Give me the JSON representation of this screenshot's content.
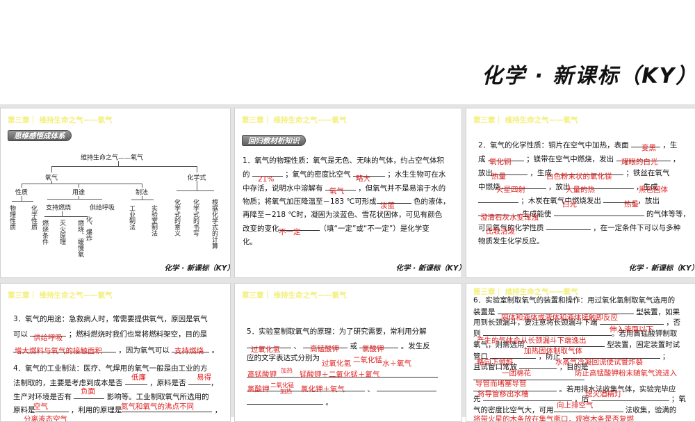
{
  "header": {
    "title": "化学 · 新课标（KY）"
  },
  "chapter": "第三章｜ 维持生命之气——氧气",
  "footer": "化学 · 新课标（KY）",
  "slide1": {
    "badge": "思维感悟成体系",
    "root": "维持生命之气——氧气",
    "oxygen": "氧气",
    "formula": "化学式",
    "property": "性质",
    "use": "用途",
    "method": "制法",
    "physical": "物理性质",
    "chemical": "化学性质",
    "support": "支持燃烧",
    "breath": "供给呼吸",
    "cond": "燃烧条件",
    "fire": "灭火原理",
    "slow1": "燃烧、缓慢氧",
    "slow2": "化、爆炸",
    "industry": "工业制法",
    "lab": "实验室制法",
    "meaning": "化学式的意义",
    "writing": "化学式的书写",
    "calc": "根据化学式的计算"
  },
  "slide2": {
    "badge": "回归教材析知识",
    "l1": "1．氧气的物理性质：氧气是无色、无味的气体，约占空气体积",
    "l2a": "的",
    "l2b": "；氧气的密度比空气",
    "l2c": "；水生生物可在水",
    "l3a": "中存活，说明水中溶解有",
    "l3b": "，但氧气并不是易溶于水的",
    "l4a": "物质；将氧气加压降温至－183 ℃可形成",
    "l4b": "色的液体，",
    "l5": "再降至－218 ℃时，凝固为淡蓝色、雪花状固体，可见有颜色",
    "l6a": "改变的变化",
    "l6b": "（填“一定”或“不一定”）是化学变",
    "l7": "化。",
    "answers": [
      "21%",
      "略大",
      "氧气",
      "淡蓝",
      "不一定"
    ]
  },
  "slide3": {
    "l1a": "2．氧气的化学性质：铜片在空气中加热，表面",
    "l1b": "，生",
    "l2a": "成",
    "l2b": "；镁带在空气中燃烧，发出",
    "l2c": "，",
    "l3a": "放出",
    "l3b": "，生成",
    "l3c": "；铁丝在氧气",
    "l4a": "中燃烧",
    "l4b": "，放出",
    "l4c": "，生成",
    "l5a": "；木炭在氧气中燃烧发出",
    "l5b": "，放出",
    "l6a": "生成能使",
    "l6b": "的气体等等，",
    "l7a": "可见氧气的化学性质",
    "l7b": "，在一定条件下可以与多种",
    "l8": "物质发生化学反应。",
    "answers": [
      "变黑",
      "氧化铜",
      "耀眼的白光",
      "热量",
      "白色粉末状的氧化镁",
      "火星四射",
      "大量的热",
      "黑色固体",
      "白光",
      "热量",
      "澄清石灰水变浑浊",
      "比较活泼"
    ]
  },
  "slide4": {
    "l1": "3．氧气的用途：急救病人时，常需要提供氧气，原因是氧气",
    "l2a": "可以",
    "l2b": "；燃料燃烧时我们也常将燃料架空，目的是",
    "l3a": "，因为氧气可以",
    "l3b": "。",
    "l4": "4．氧气的工业制法：医疗、气焊用的氧气一般是由工业的方",
    "l5a": "法制取的，主要是考虑到成本是否",
    "l5b": "，原料是否",
    "l5c": "，",
    "l6a": "生产对环境是否有",
    "l6b": "影响等。工业制取氧气所选用的",
    "l7a": "原料是",
    "l7b": "，利用的原理是",
    "l7c": "，",
    "answers": [
      "供给呼吸",
      "增大燃料与氧气的接触面积",
      "支持燃烧",
      "低廉",
      "易得",
      "负面",
      "空气",
      "氮气和氧气的沸点不同",
      "分离液态空气"
    ]
  },
  "slide5": {
    "l1": "5．实验室制取氧气的原理：为了研究需要，常利用分解",
    "l2a": "、",
    "l2b": "或",
    "l2c": "。发生反",
    "l3": "应的文字表达式分别为",
    "l5": "、",
    "l6": "。",
    "answers": [
      "过氧化氢",
      "高锰酸钾",
      "氯酸钾",
      "过氧化氢",
      "二氧化锰",
      "水＋氧气",
      "高锰酸钾",
      "加热",
      "锰酸钾＋二氧化锰＋氧气",
      "氯酸钾",
      "二氧化锰",
      "加热",
      "氯化钾＋氧气"
    ]
  },
  "slide6": {
    "l1": "6．实验室制取氧气的装置和操作：用过氧化氢制取氧气选用的",
    "l2a": "装置是",
    "l2b": "型装置，如果",
    "l3a": "用到长颈漏斗，要注意将长颈漏斗下端",
    "l3b": "，否",
    "l4a": "则",
    "l4b": "。若用高锰酸钾制取",
    "l5a": "氧气，则需选用",
    "l5b": "型装置，固定装置时试",
    "l6a": "管口",
    "l6b": "，防止",
    "l6c": "；",
    "l7a": "且试管口常放",
    "l7b": "，目的是",
    "l9": "。若用排水法收集气体，实验完毕应",
    "l10a": "先",
    "l10b": "，后",
    "l10c": "；氧",
    "l11a": "气的密度比空气大，可用",
    "l11b": "法收集，验满的",
    "answers": [
      "固体和液体或液体和液体接触即反应",
      "伸入液面以下",
      "产生的气体会从长颈漏斗下端逸出",
      "加热固体制取气体",
      "略向下倾斜",
      "水蒸气冷凝回流使试管炸裂",
      "一团棉花",
      "防止高锰酸钾粉末随氧气流进入",
      "导管而堵塞导管",
      "将导管移出水槽",
      "熄灭酒精灯",
      "向上排空气",
      "将带火星的木条放在集气瓶口，观察木条是否复燃"
    ]
  }
}
